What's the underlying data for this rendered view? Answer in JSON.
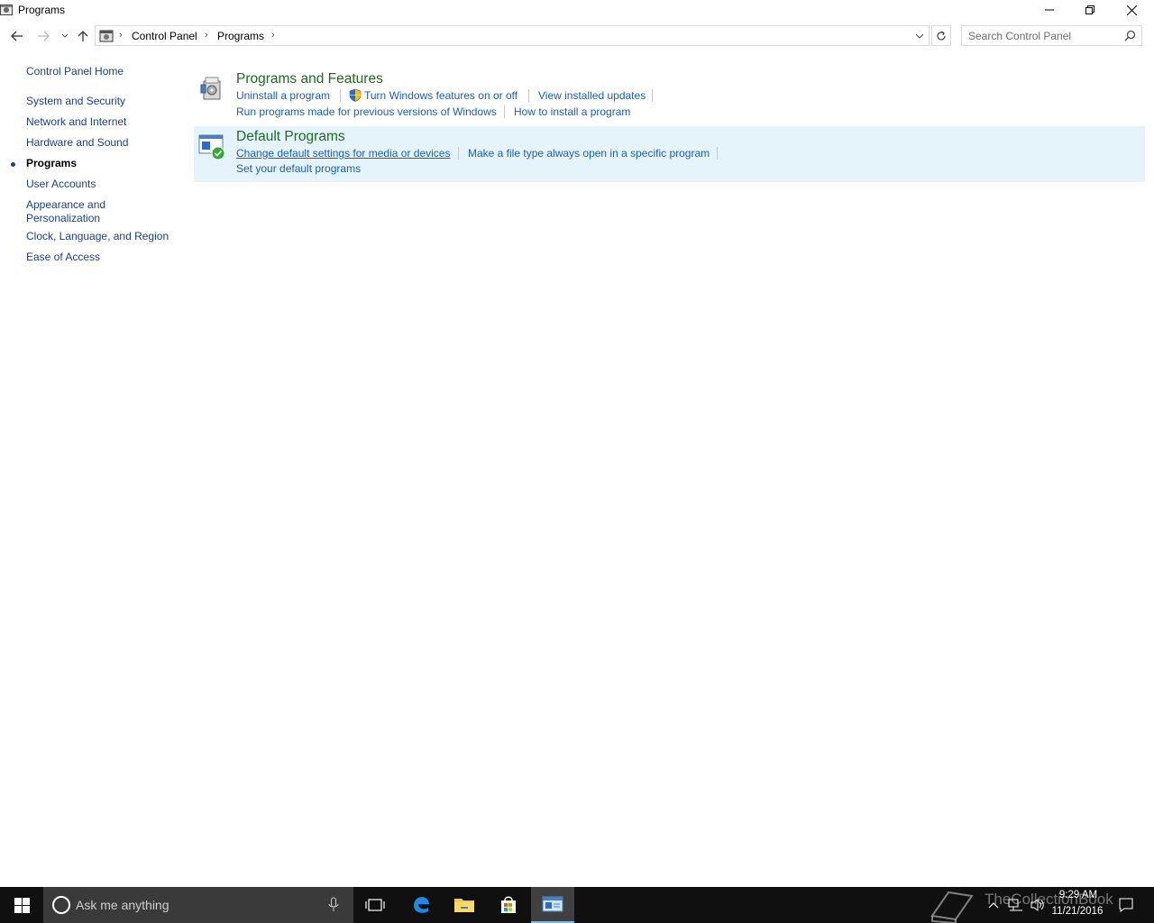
{
  "window": {
    "title": "Programs"
  },
  "address": {
    "crumbs": [
      "Control Panel",
      "Programs"
    ],
    "search_placeholder": "Search Control Panel"
  },
  "sidebar": {
    "home": "Control Panel Home",
    "items": [
      {
        "label": "System and Security"
      },
      {
        "label": "Network and Internet"
      },
      {
        "label": "Hardware and Sound"
      },
      {
        "label": "Programs",
        "active": true
      },
      {
        "label": "User Accounts"
      },
      {
        "label": "Appearance and Personalization"
      },
      {
        "label": "Clock, Language, and Region"
      },
      {
        "label": "Ease of Access"
      }
    ]
  },
  "categories": [
    {
      "title": "Programs and Features",
      "links": [
        "Uninstall a program",
        "Turn Windows features on or off",
        "View installed updates",
        "Run programs made for previous versions of Windows",
        "How to install a program"
      ]
    },
    {
      "title": "Default Programs",
      "links": [
        "Change default settings for media or devices",
        "Make a file type always open in a specific program",
        "Set your default programs"
      ]
    }
  ],
  "taskbar": {
    "search_placeholder": "Ask me anything",
    "time": "9:29 AM",
    "date": "11/21/2016",
    "watermark": "TheCollectionBook"
  },
  "colors": {
    "link": "#1a5fb4",
    "category_title": "#1e6a1e",
    "selected_bg": "#e5f3fb",
    "taskbar_bg": "#101010"
  }
}
